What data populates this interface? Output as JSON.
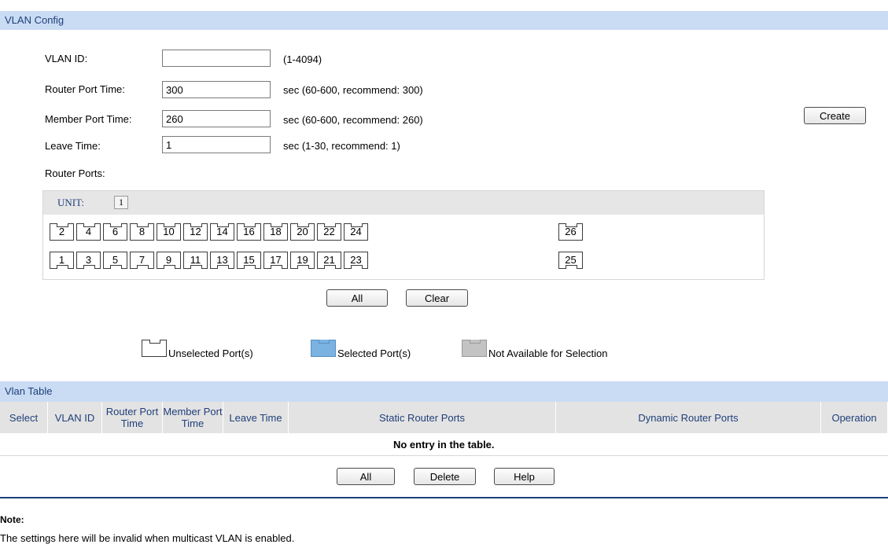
{
  "vlan_config": {
    "title": "VLAN Config",
    "vlan_id": {
      "label": "VLAN ID:",
      "value": "",
      "hint": "(1-4094)"
    },
    "router_port_time": {
      "label": "Router Port Time:",
      "value": "300",
      "hint": "sec (60-600, recommend: 300)"
    },
    "member_port_time": {
      "label": "Member Port Time:",
      "value": "260",
      "hint": "sec (60-600, recommend: 260)"
    },
    "leave_time": {
      "label": "Leave Time:",
      "value": "1",
      "hint": "sec (1-30, recommend: 1)"
    },
    "create_label": "Create",
    "router_ports_label": "Router Ports:",
    "unit_label": "UNIT:",
    "unit_value": "1",
    "ports_even": [
      "2",
      "4",
      "6",
      "8",
      "10",
      "12",
      "14",
      "16",
      "18",
      "20",
      "22",
      "24"
    ],
    "ports_odd": [
      "1",
      "3",
      "5",
      "7",
      "9",
      "11",
      "13",
      "15",
      "17",
      "19",
      "21",
      "23"
    ],
    "port_26": "26",
    "port_25": "25",
    "all_label": "All",
    "clear_label": "Clear"
  },
  "legend": {
    "unselected": "Unselected Port(s)",
    "selected": "Selected Port(s)",
    "not_available": "Not Available for Selection",
    "colors": {
      "selected": "#7ab3e2",
      "not_available": "#c3c3c3"
    }
  },
  "vlan_table": {
    "title": "Vlan Table",
    "columns": [
      "Select",
      "VLAN ID",
      "Router Port Time",
      "Member Port Time",
      "Leave Time",
      "Static Router Ports",
      "Dynamic Router Ports",
      "Operation"
    ],
    "empty_message": "No entry in the table.",
    "all_label": "All",
    "delete_label": "Delete",
    "help_label": "Help"
  },
  "note": {
    "title": "Note:",
    "text": "The settings here will be invalid when multicast VLAN is enabled."
  }
}
